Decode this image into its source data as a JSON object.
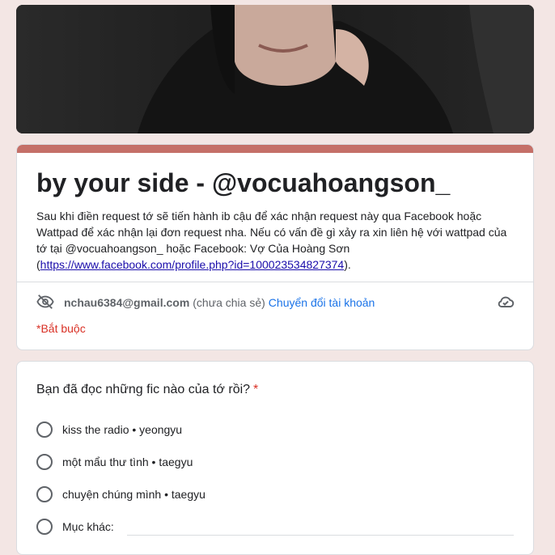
{
  "header": {
    "title": "by your side - @vocuahoangson_",
    "description_text": "Sau khi điền request tớ sẽ tiến hành ib cậu để xác nhận request này qua Facebook hoặc Wattpad để xác nhận lại đơn request nha. Nếu có vấn đề gì xảy ra xin liên hệ với wattpad của tớ tại @vocuahoangson_ hoặc Facebook: Vợ Của Hoàng Sơn (",
    "description_link": "https://www.facebook.com/profile.php?id=100023534827374",
    "description_end": ").",
    "accent_color": "#c57068"
  },
  "account": {
    "email": "nchau6384@gmail.com",
    "not_shared": "(chưa chia sẻ)",
    "switch_label": "Chuyển đổi tài khoản"
  },
  "required_note": "*Bắt buộc",
  "question": {
    "title": "Bạn đã đọc những fic nào của tớ rồi?",
    "required_mark": "*",
    "options": [
      "kiss the radio • yeongyu",
      "một mẩu thư tình • taegyu",
      "chuyện chúng mình • taegyu"
    ],
    "other_label": "Mục khác:"
  }
}
